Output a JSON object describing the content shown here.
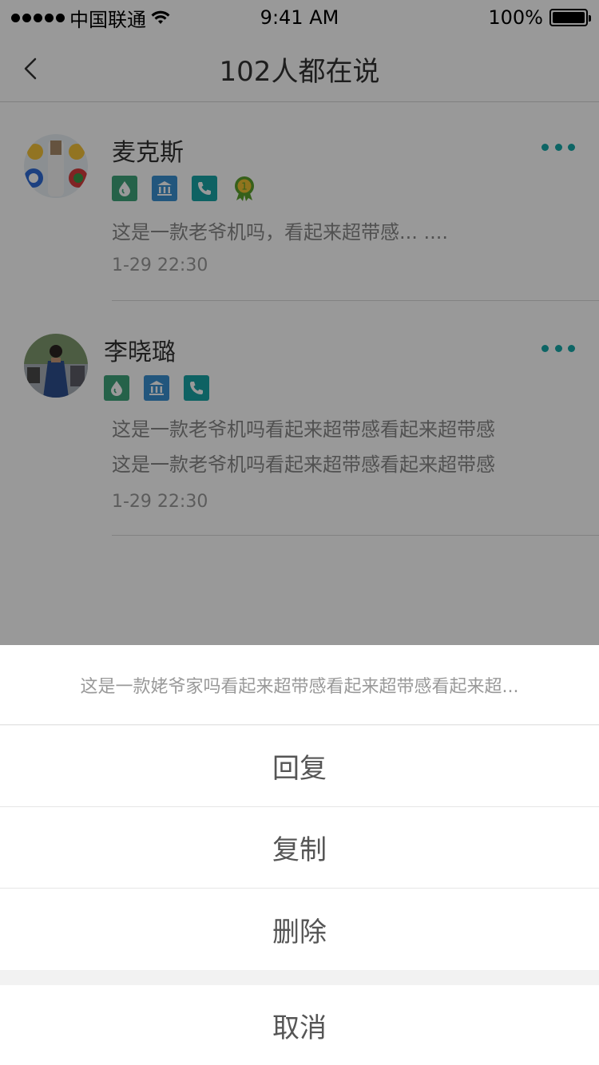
{
  "status_bar": {
    "carrier": "中国联通",
    "time": "9:41 AM",
    "battery": "100%",
    "battery_level": 100
  },
  "nav": {
    "title": "102人都在说"
  },
  "comments": [
    {
      "name": "麦克斯",
      "content_lines": [
        "这是一款老爷机吗，看起来超带感... ...."
      ],
      "time": "1-29 22:30",
      "medal_number": "1"
    },
    {
      "name": "李晓璐",
      "content_lines": [
        "这是一款老爷机吗看起来超带感看起来超带感",
        "这是一款老爷机吗看起来超带感看起来超带感"
      ],
      "time": "1-29 22:30"
    }
  ],
  "action_sheet": {
    "preview": "这是一款姥爷家吗看起来超带感看起来超带感看起来超...",
    "options": [
      "回复",
      "复制",
      "删除"
    ],
    "cancel": "取消"
  },
  "colors": {
    "accent": "#16a8a8",
    "badge_green": "#3ea37a",
    "badge_blue": "#3a8fd0",
    "badge_teal": "#18a3a6",
    "medal": "#5aa02c"
  }
}
